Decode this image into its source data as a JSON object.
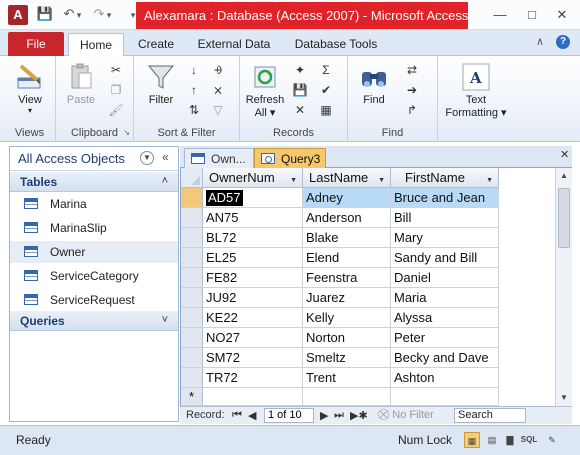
{
  "window": {
    "title": "Alexamara : Database (Access 2007)  -  Microsoft Access (...",
    "app_icon_letter": "A",
    "buttons": {
      "minimize": "—",
      "maximize": "□",
      "close": "✕"
    }
  },
  "quick_access": {
    "save_icon": "save-icon",
    "undo_icon": "undo-icon",
    "redo_icon": "redo-icon"
  },
  "ribbon_tabs": {
    "file": "File",
    "home": "Home",
    "create": "Create",
    "external": "External Data",
    "dbtools": "Database Tools",
    "active": "Home"
  },
  "ribbon": {
    "views": {
      "view_label": "View",
      "group_label": "Views"
    },
    "clipboard": {
      "paste_label": "Paste",
      "group_label": "Clipboard"
    },
    "sort_filter": {
      "filter_label": "Filter",
      "group_label": "Sort & Filter"
    },
    "records": {
      "refresh_label": "Refresh",
      "refresh_sub": "All",
      "group_label": "Records"
    },
    "find": {
      "find_label": "Find",
      "group_label": "Find"
    },
    "text_formatting": {
      "label_line1": "Text",
      "label_line2": "Formatting",
      "group_label": ""
    }
  },
  "nav_pane": {
    "title": "All Access Objects",
    "tables_section": "Tables",
    "tables": [
      "Marina",
      "MarinaSlip",
      "Owner",
      "ServiceCategory",
      "ServiceRequest"
    ],
    "selected_table": "Owner",
    "queries_section": "Queries"
  },
  "doc_tabs": {
    "owner_tab": "Own...",
    "query_tab": "Query3",
    "active": "Query3"
  },
  "datasheet": {
    "columns": [
      "OwnerNum",
      "LastName",
      "FirstName"
    ],
    "rows": [
      [
        "AD57",
        "Adney",
        "Bruce and Jean"
      ],
      [
        "AN75",
        "Anderson",
        "Bill"
      ],
      [
        "BL72",
        "Blake",
        "Mary"
      ],
      [
        "EL25",
        "Elend",
        "Sandy and Bill"
      ],
      [
        "FE82",
        "Feenstra",
        "Daniel"
      ],
      [
        "JU92",
        "Juarez",
        "Maria"
      ],
      [
        "KE22",
        "Kelly",
        "Alyssa"
      ],
      [
        "NO27",
        "Norton",
        "Peter"
      ],
      [
        "SM72",
        "Smeltz",
        "Becky and Dave"
      ],
      [
        "TR72",
        "Trent",
        "Ashton"
      ]
    ],
    "new_row_marker": "*"
  },
  "record_nav": {
    "label": "Record:",
    "position": "1 of 10",
    "no_filter": "No Filter",
    "search_placeholder": "Search"
  },
  "status_bar": {
    "ready": "Ready",
    "num_lock": "Num Lock"
  }
}
